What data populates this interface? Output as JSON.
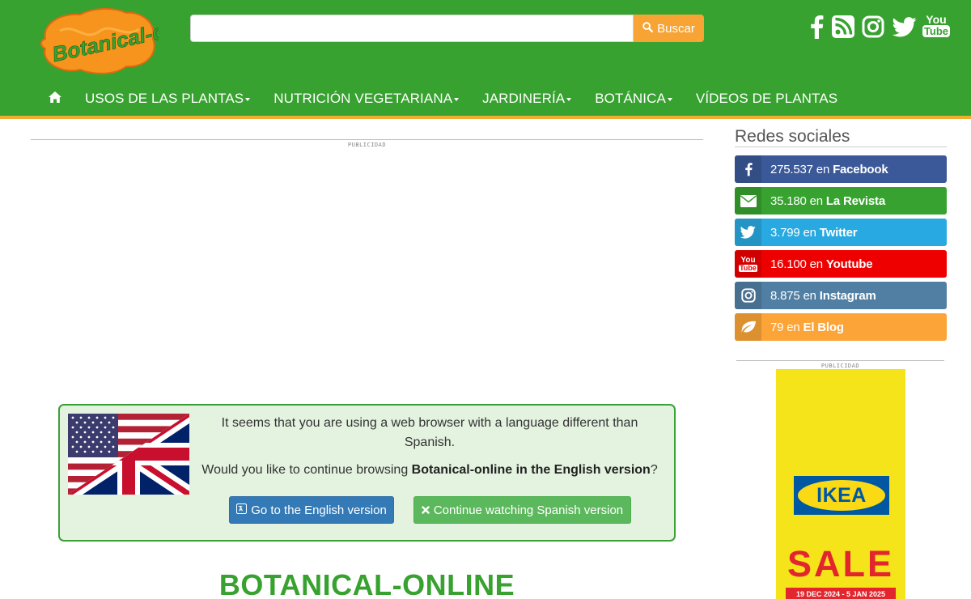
{
  "header": {
    "logo_text": "Botanical-online",
    "search": {
      "placeholder": "",
      "button_label": "Buscar"
    },
    "social_icons": [
      "facebook-icon",
      "rss-icon",
      "instagram-icon",
      "twitter-icon",
      "youtube-icon"
    ],
    "youtube_icon_text": {
      "line1": "You",
      "line2": "Tube"
    }
  },
  "nav": {
    "items": [
      {
        "label": "USOS DE LAS PLANTAS",
        "dropdown": true
      },
      {
        "label": "NUTRICIÓN VEGETARIANA",
        "dropdown": true
      },
      {
        "label": "JARDINERÍA",
        "dropdown": true
      },
      {
        "label": "BOTÁNICA",
        "dropdown": true
      },
      {
        "label": "VÍDEOS DE PLANTAS",
        "dropdown": false
      }
    ]
  },
  "main": {
    "ad_label": "PUBLICIDAD",
    "language_notice": {
      "line1": "It seems that you are using a web browser with a language different than Spanish.",
      "line2_prefix": "Would you like to continue browsing ",
      "line2_bold": "Botanical-online in the English version",
      "line2_suffix": "?",
      "english_button": "Go to the English version",
      "spanish_button": "Continue watching Spanish version"
    },
    "site_title": "BOTANICAL-ONLINE"
  },
  "sidebar": {
    "title": "Redes sociales",
    "networks": [
      {
        "count": "275.537",
        "joiner": "en",
        "name": "Facebook",
        "color": "#3b5998",
        "icon": "facebook-icon"
      },
      {
        "count": "35.180",
        "joiner": "en",
        "name": "La Revista",
        "color": "#37a22f",
        "icon": "envelope-icon"
      },
      {
        "count": "3.799",
        "joiner": "en",
        "name": "Twitter",
        "color": "#29a9e1",
        "icon": "twitter-icon"
      },
      {
        "count": "16.100",
        "joiner": "en",
        "name": "Youtube",
        "color": "#ee0000",
        "icon": "youtube-icon"
      },
      {
        "count": "8.875",
        "joiner": "en",
        "name": "Instagram",
        "color": "#517fa4",
        "icon": "instagram-icon"
      },
      {
        "count": "79",
        "joiner": "en",
        "name": "El Blog",
        "color": "#fca437",
        "icon": "leaf-icon"
      }
    ],
    "ad_label": "PUBLICIDAD",
    "ad": {
      "brand": "IKEA",
      "headline": "SALE",
      "dates": "19 DEC 2024 - 5 JAN 2025"
    }
  },
  "colors": {
    "brand_green": "#37a22f",
    "accent_orange": "#f7a435",
    "stripe": "#f0ad2f"
  }
}
